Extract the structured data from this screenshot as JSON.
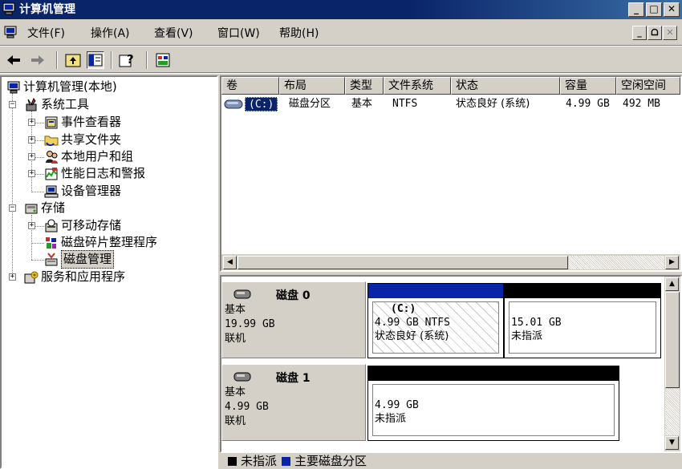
{
  "window": {
    "title": "计算机管理"
  },
  "menubar": {
    "items": [
      "文件(F)",
      "操作(A)",
      "查看(V)",
      "窗口(W)",
      "帮助(H)"
    ]
  },
  "toolbar": {
    "buttons": [
      "back-arrow",
      "forward-arrow",
      "up-folder",
      "show-hide-tree",
      "help",
      "properties"
    ]
  },
  "tree": {
    "root": "计算机管理(本地)",
    "nodes": [
      {
        "label": "系统工具",
        "icon": "tools-icon"
      },
      {
        "label": "事件查看器",
        "icon": "event-viewer-icon"
      },
      {
        "label": "共享文件夹",
        "icon": "shared-folder-icon"
      },
      {
        "label": "本地用户和组",
        "icon": "users-icon"
      },
      {
        "label": "性能日志和警报",
        "icon": "performance-icon"
      },
      {
        "label": "设备管理器",
        "icon": "device-manager-icon"
      },
      {
        "label": "存储",
        "icon": "storage-icon"
      },
      {
        "label": "可移动存储",
        "icon": "removable-storage-icon"
      },
      {
        "label": "磁盘碎片整理程序",
        "icon": "defrag-icon"
      },
      {
        "label": "磁盘管理",
        "icon": "disk-management-icon"
      },
      {
        "label": "服务和应用程序",
        "icon": "services-icon"
      }
    ]
  },
  "volumes": {
    "columns": [
      "卷",
      "布局",
      "类型",
      "文件系统",
      "状态",
      "容量",
      "空闲空间"
    ],
    "rows": [
      {
        "volume": "(C:)",
        "layout": "磁盘分区",
        "type": "基本",
        "fs": "NTFS",
        "status": "状态良好 (系统)",
        "capacity": "4.99 GB",
        "free": "492 MB"
      }
    ]
  },
  "disks": [
    {
      "name": "磁盘 0",
      "type": "基本",
      "size": "19.99 GB",
      "state": "联机",
      "partitions": [
        {
          "label": "(C:)",
          "line2": "4.99 GB NTFS",
          "line3": "状态良好 (系统)",
          "bar_color": "#0a24a8"
        },
        {
          "label": "",
          "line2": "15.01 GB",
          "line3": "未指派",
          "bar_color": "#000000"
        }
      ]
    },
    {
      "name": "磁盘 1",
      "type": "基本",
      "size": "4.99 GB",
      "state": "联机",
      "partitions": [
        {
          "label": "",
          "line2": "4.99 GB",
          "line3": "未指派",
          "bar_color": "#000000"
        }
      ]
    }
  ],
  "legend": {
    "items": [
      {
        "label": "未指派",
        "color": "#000000"
      },
      {
        "label": "主要磁盘分区",
        "color": "#0a24a8"
      }
    ]
  }
}
